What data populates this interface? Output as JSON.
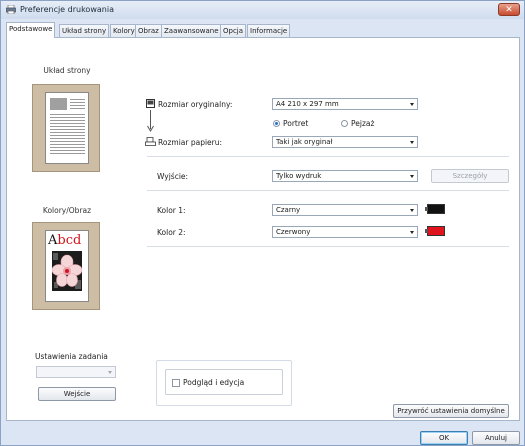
{
  "window": {
    "title": "Preferencje drukowania",
    "close_label": "✕"
  },
  "tabs": [
    {
      "label": "Podstawowe"
    },
    {
      "label": "Układ strony"
    },
    {
      "label": "Kolory"
    },
    {
      "label": "Obraz"
    },
    {
      "label": "Zaawansowane"
    },
    {
      "label": "Opcja"
    },
    {
      "label": "Informacje"
    }
  ],
  "left": {
    "layout_title": "Układ strony",
    "color_title": "Kolory/Obraz",
    "color_sample_letters": [
      "A",
      "b",
      "c",
      "d"
    ],
    "job_settings": {
      "title": "Ustawienia zadania",
      "select_value": "",
      "input_button": "Wejście"
    }
  },
  "form": {
    "original_size": {
      "label": "Rozmiar oryginalny:",
      "value": "A4 210 x 297 mm"
    },
    "orientation": {
      "portrait": "Portret",
      "landscape": "Pejzaż",
      "selected": "portrait"
    },
    "paper_size": {
      "label": "Rozmiar papieru:",
      "value": "Taki jak oryginał"
    },
    "output": {
      "label": "Wyjście:",
      "value": "Tylko wydruk",
      "details_button": "Szczegóły"
    },
    "color1": {
      "label": "Kolor 1:",
      "value": "Czarny",
      "swatch": "#111111"
    },
    "color2": {
      "label": "Kolor 2:",
      "value": "Czerwony",
      "swatch": "#e0141e"
    }
  },
  "preview_edit": {
    "label": "Podgląd i edycja",
    "checked": false
  },
  "restore_button": "Przywróć ustawienia domyślne",
  "footer": {
    "ok": "OK",
    "cancel": "Anuluj"
  }
}
